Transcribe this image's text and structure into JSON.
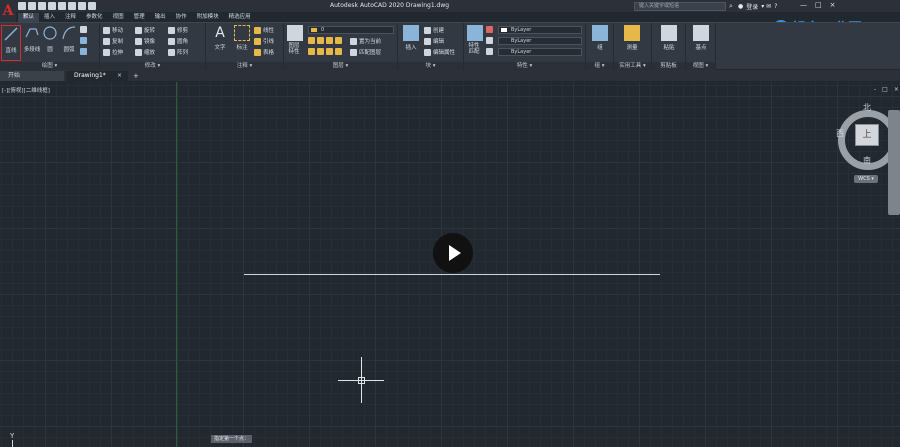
{
  "app": {
    "logo_letter": "A",
    "title": "Autodesk AutoCAD 2020    Drawing1.dwg",
    "search_placeholder": "键入关键字或短语",
    "login_label": "登录",
    "help": "?"
  },
  "ribbon_tabs": [
    "默认",
    "插入",
    "注释",
    "参数化",
    "视图",
    "管理",
    "输出",
    "协作",
    "附加模块",
    "精选应用"
  ],
  "ribbon": {
    "draw": {
      "title": "绘图 ▾",
      "line": "直线",
      "polyline": "多段线",
      "circle": "圆",
      "arc": "圆弧"
    },
    "modify": {
      "title": "修改 ▾",
      "move": "移动",
      "rotate": "旋转",
      "trim": "修剪",
      "copy": "复制",
      "mirror": "镜像",
      "fillet": "圆角",
      "stretch": "拉伸",
      "scale": "缩放",
      "array": "阵列"
    },
    "annotation": {
      "title": "注释 ▾",
      "text": "文字",
      "dimension": "标注",
      "linear": "线性",
      "leader": "引线",
      "table": "表格"
    },
    "layers": {
      "title": "图层 ▾",
      "properties": "图层特性",
      "current_layer": "0",
      "set_current": "置为当前",
      "match_layer": "匹配图层"
    },
    "block": {
      "title": "块 ▾",
      "insert": "插入",
      "create": "创建",
      "edit": "编辑",
      "edit_attributes": "编辑属性"
    },
    "properties": {
      "title": "特性 ▾",
      "match": "特性匹配",
      "color": "ByLayer",
      "linetype": "ByLayer",
      "lineweight": "ByLayer"
    },
    "groups": {
      "title": "组 ▾",
      "group": "组"
    },
    "utilities": {
      "title": "实用工具 ▾",
      "measure": "测量"
    },
    "clipboard": {
      "title": "剪贴板",
      "paste": "粘贴"
    },
    "view": {
      "title": "视图 ▾",
      "base": "基点"
    }
  },
  "doc_tabs": {
    "start": "开始",
    "drawing": "Drawing1*",
    "close": "×",
    "add": "+"
  },
  "canvas": {
    "viewport_label": "[-][俯视][二维线框]",
    "command_prompt": "指定第一个点：",
    "ucs_y": "Y"
  },
  "viewcube": {
    "north": "北",
    "south": "南",
    "east": "东",
    "west": "西",
    "face": "上",
    "wcs": "WCS ▾"
  },
  "viewport_controls": [
    "-",
    "□",
    "×"
  ],
  "window_controls": [
    "—",
    "□",
    "×"
  ],
  "watermark": "轻之工业网"
}
